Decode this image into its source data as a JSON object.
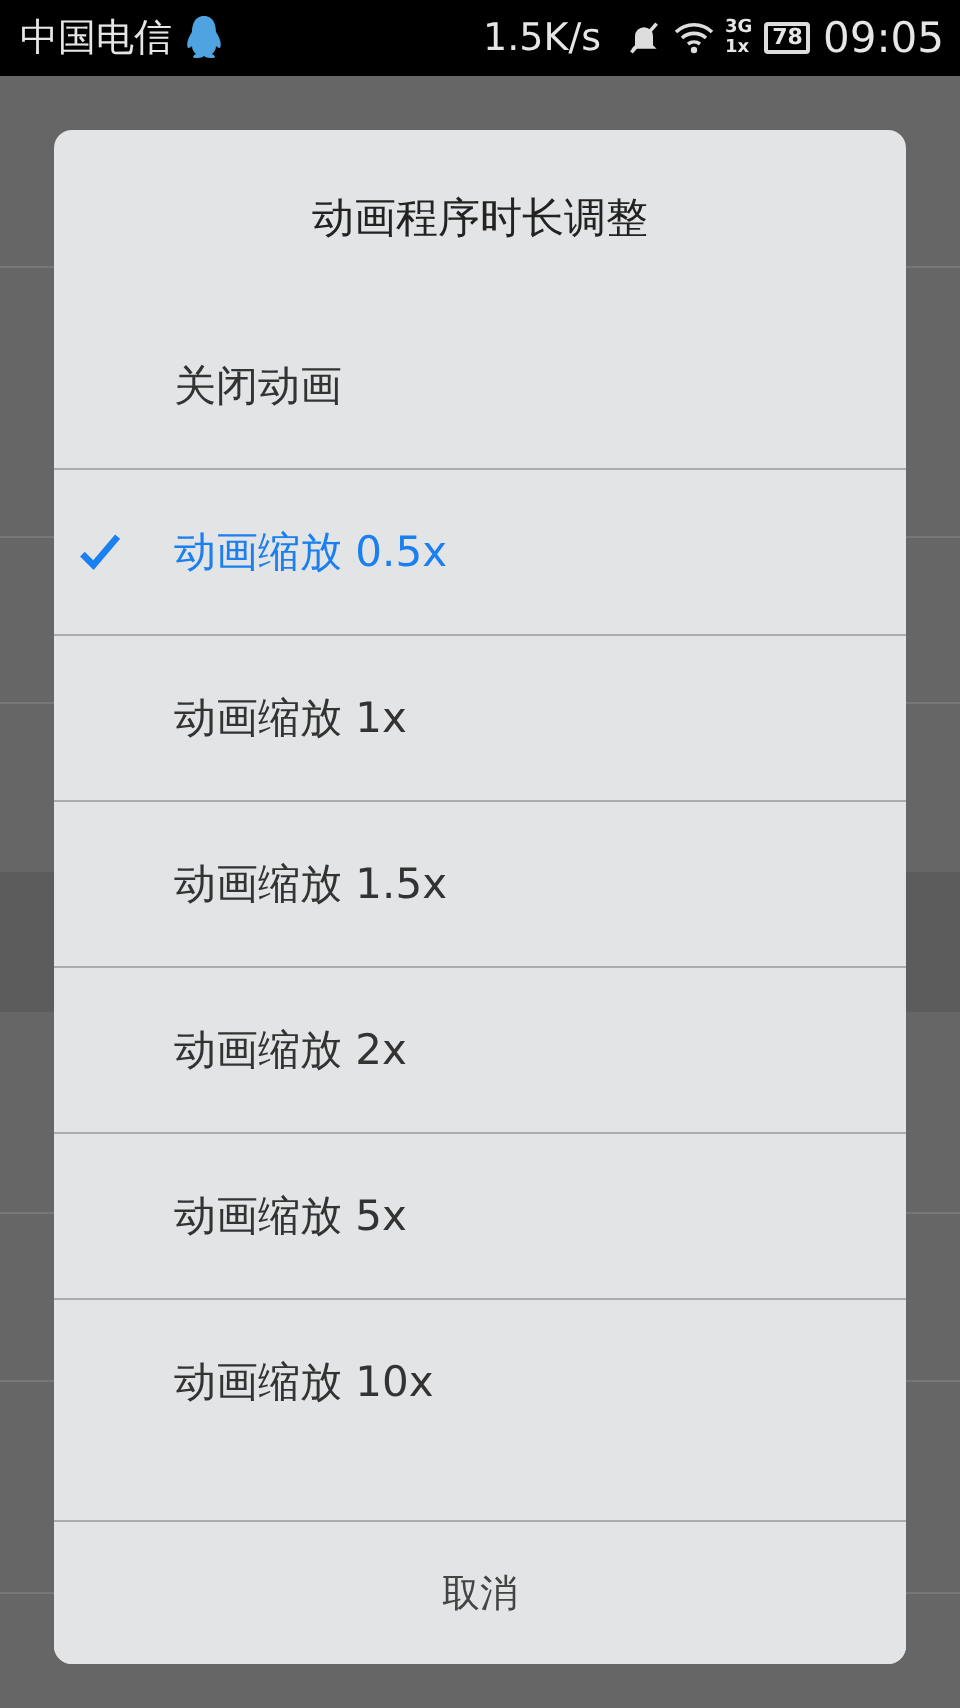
{
  "status_bar": {
    "carrier": "中国电信",
    "speed": "1.5K/s",
    "network_top": "3G",
    "network_bottom": "1x",
    "battery": "78",
    "time": "09:05"
  },
  "dialog": {
    "title": "动画程序时长调整",
    "options": [
      {
        "label": "关闭动画",
        "selected": false
      },
      {
        "label": "动画缩放 0.5x",
        "selected": true
      },
      {
        "label": "动画缩放 1x",
        "selected": false
      },
      {
        "label": "动画缩放 1.5x",
        "selected": false
      },
      {
        "label": "动画缩放 2x",
        "selected": false
      },
      {
        "label": "动画缩放 5x",
        "selected": false
      },
      {
        "label": "动画缩放 10x",
        "selected": false
      }
    ],
    "cancel": "取消"
  }
}
